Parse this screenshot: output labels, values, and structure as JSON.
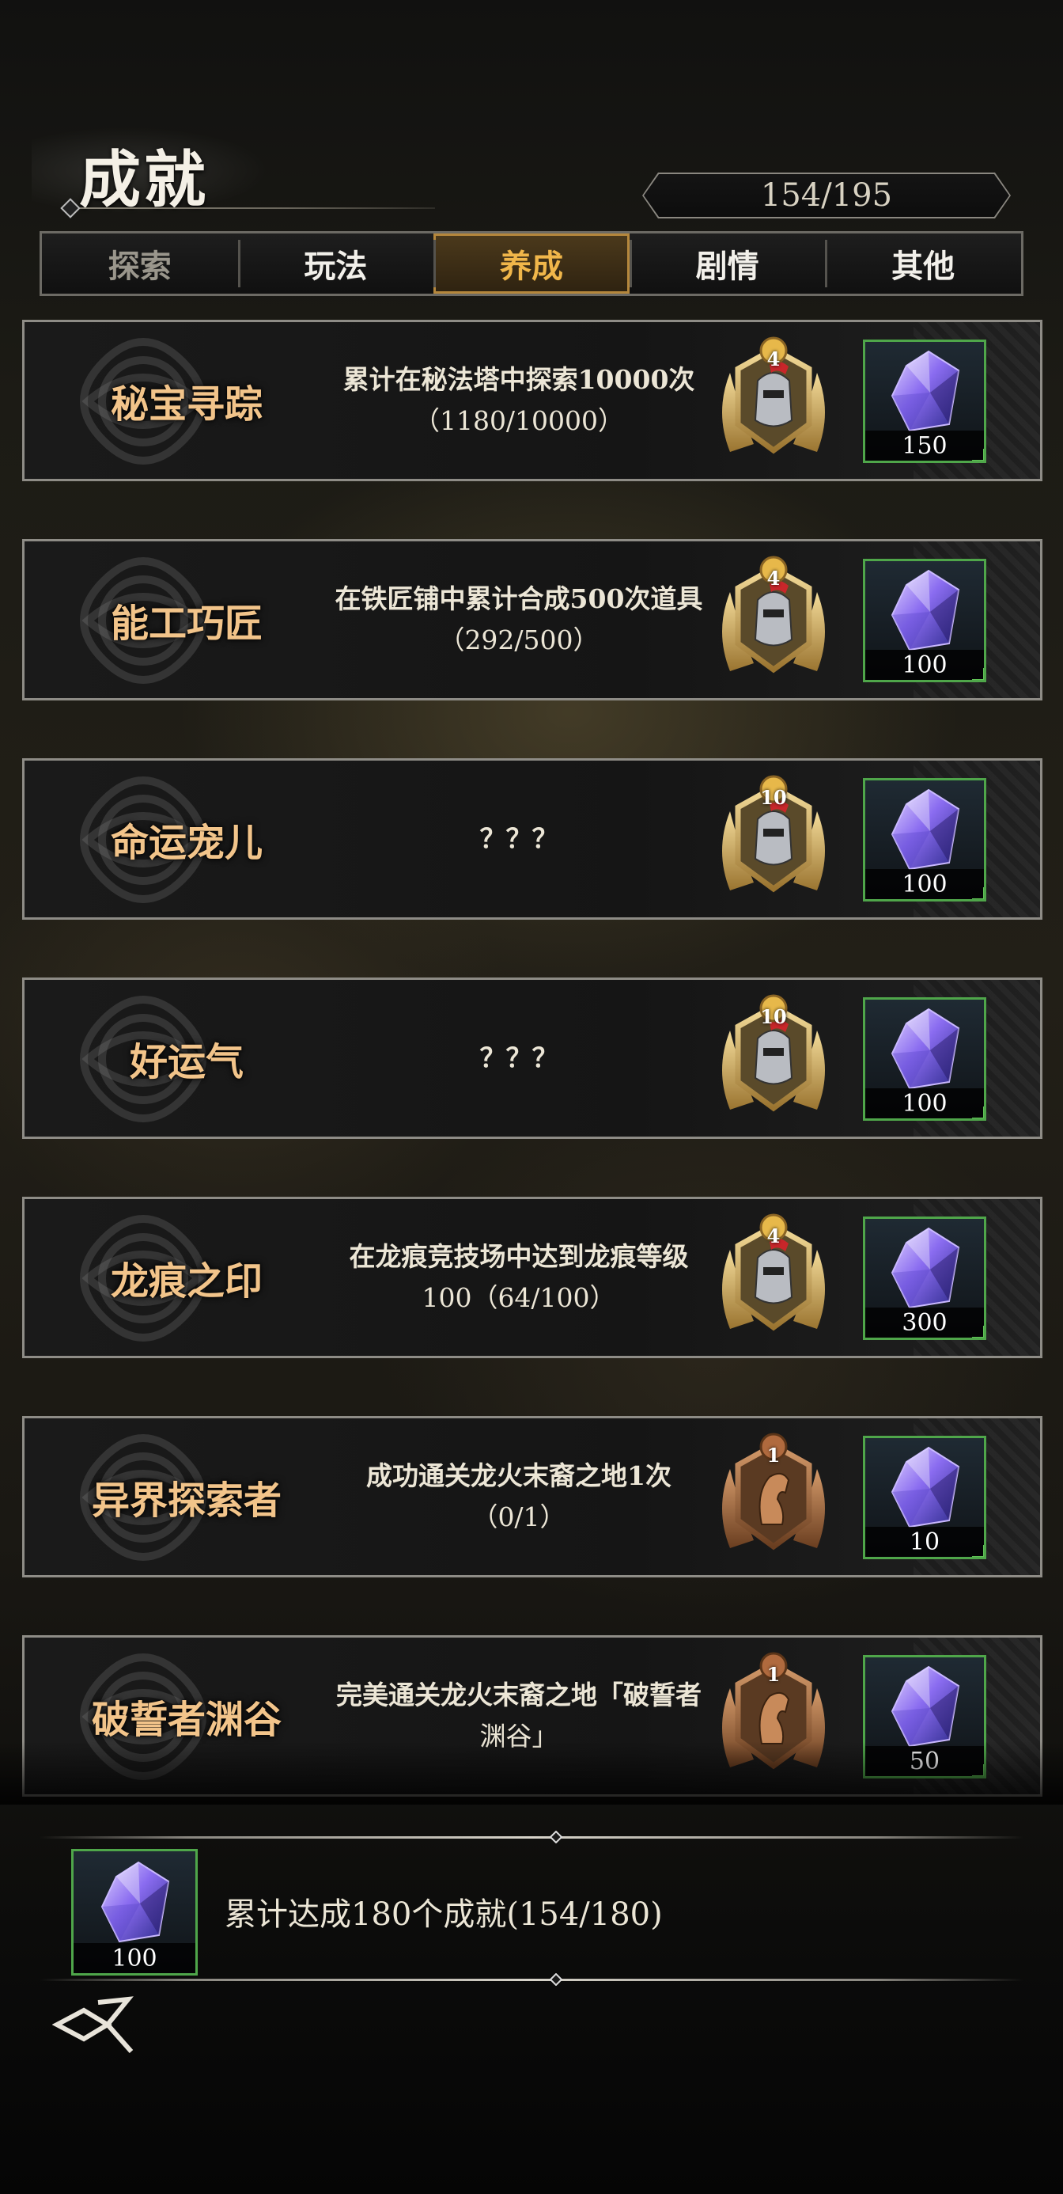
{
  "header": {
    "title": "成就",
    "progress": "154/195"
  },
  "tabs": [
    {
      "label": "探索",
      "state": "dim"
    },
    {
      "label": "玩法",
      "state": "normal"
    },
    {
      "label": "养成",
      "state": "active"
    },
    {
      "label": "剧情",
      "state": "normal"
    },
    {
      "label": "其他",
      "state": "normal"
    }
  ],
  "achievements": [
    {
      "name": "秘宝寻踪",
      "desc": "累计在秘法塔中探索10000次",
      "progress": "（1180/10000）",
      "medal_level": "4",
      "medal_type": "knight-helmet-silver-icon",
      "reward_qty": "150"
    },
    {
      "name": "能工巧匠",
      "desc": "在铁匠铺中累计合成500次道具",
      "progress": "（292/500）",
      "medal_level": "4",
      "medal_type": "knight-helmet-silver-icon",
      "reward_qty": "100"
    },
    {
      "name": "命运宠儿",
      "desc": "？？？",
      "progress": "",
      "medal_level": "10",
      "medal_type": "knight-helmet-silver-icon",
      "reward_qty": "100"
    },
    {
      "name": "好运气",
      "desc": "？？？",
      "progress": "",
      "medal_level": "10",
      "medal_type": "knight-helmet-silver-icon",
      "reward_qty": "100"
    },
    {
      "name": "龙痕之印",
      "desc": "在龙痕竞技场中达到龙痕等级",
      "progress": "100（64/100）",
      "medal_level": "4",
      "medal_type": "knight-helmet-silver-icon",
      "reward_qty": "300"
    },
    {
      "name": "异界探索者",
      "desc": "成功通关龙火末裔之地1次",
      "progress": "（0/1）",
      "medal_level": "1",
      "medal_type": "horse-head-bronze-icon",
      "reward_qty": "10"
    },
    {
      "name": "破誓者渊谷",
      "desc": "完美通关龙火末裔之地「破誓者",
      "progress": "渊谷」",
      "medal_level": "1",
      "medal_type": "horse-head-bronze-icon",
      "reward_qty": "50"
    }
  ],
  "summary": {
    "text": "累计达成180个成就(154/180)",
    "reward_qty": "100"
  },
  "icons": {
    "reward": "purple-crystal-icon",
    "back": "back-arrow-icon",
    "knot": "celtic-knot-icon"
  },
  "colors": {
    "accent_gold": "#f0b64a",
    "name_gold": "#f2c48a",
    "reward_border": "#4fa64a"
  }
}
